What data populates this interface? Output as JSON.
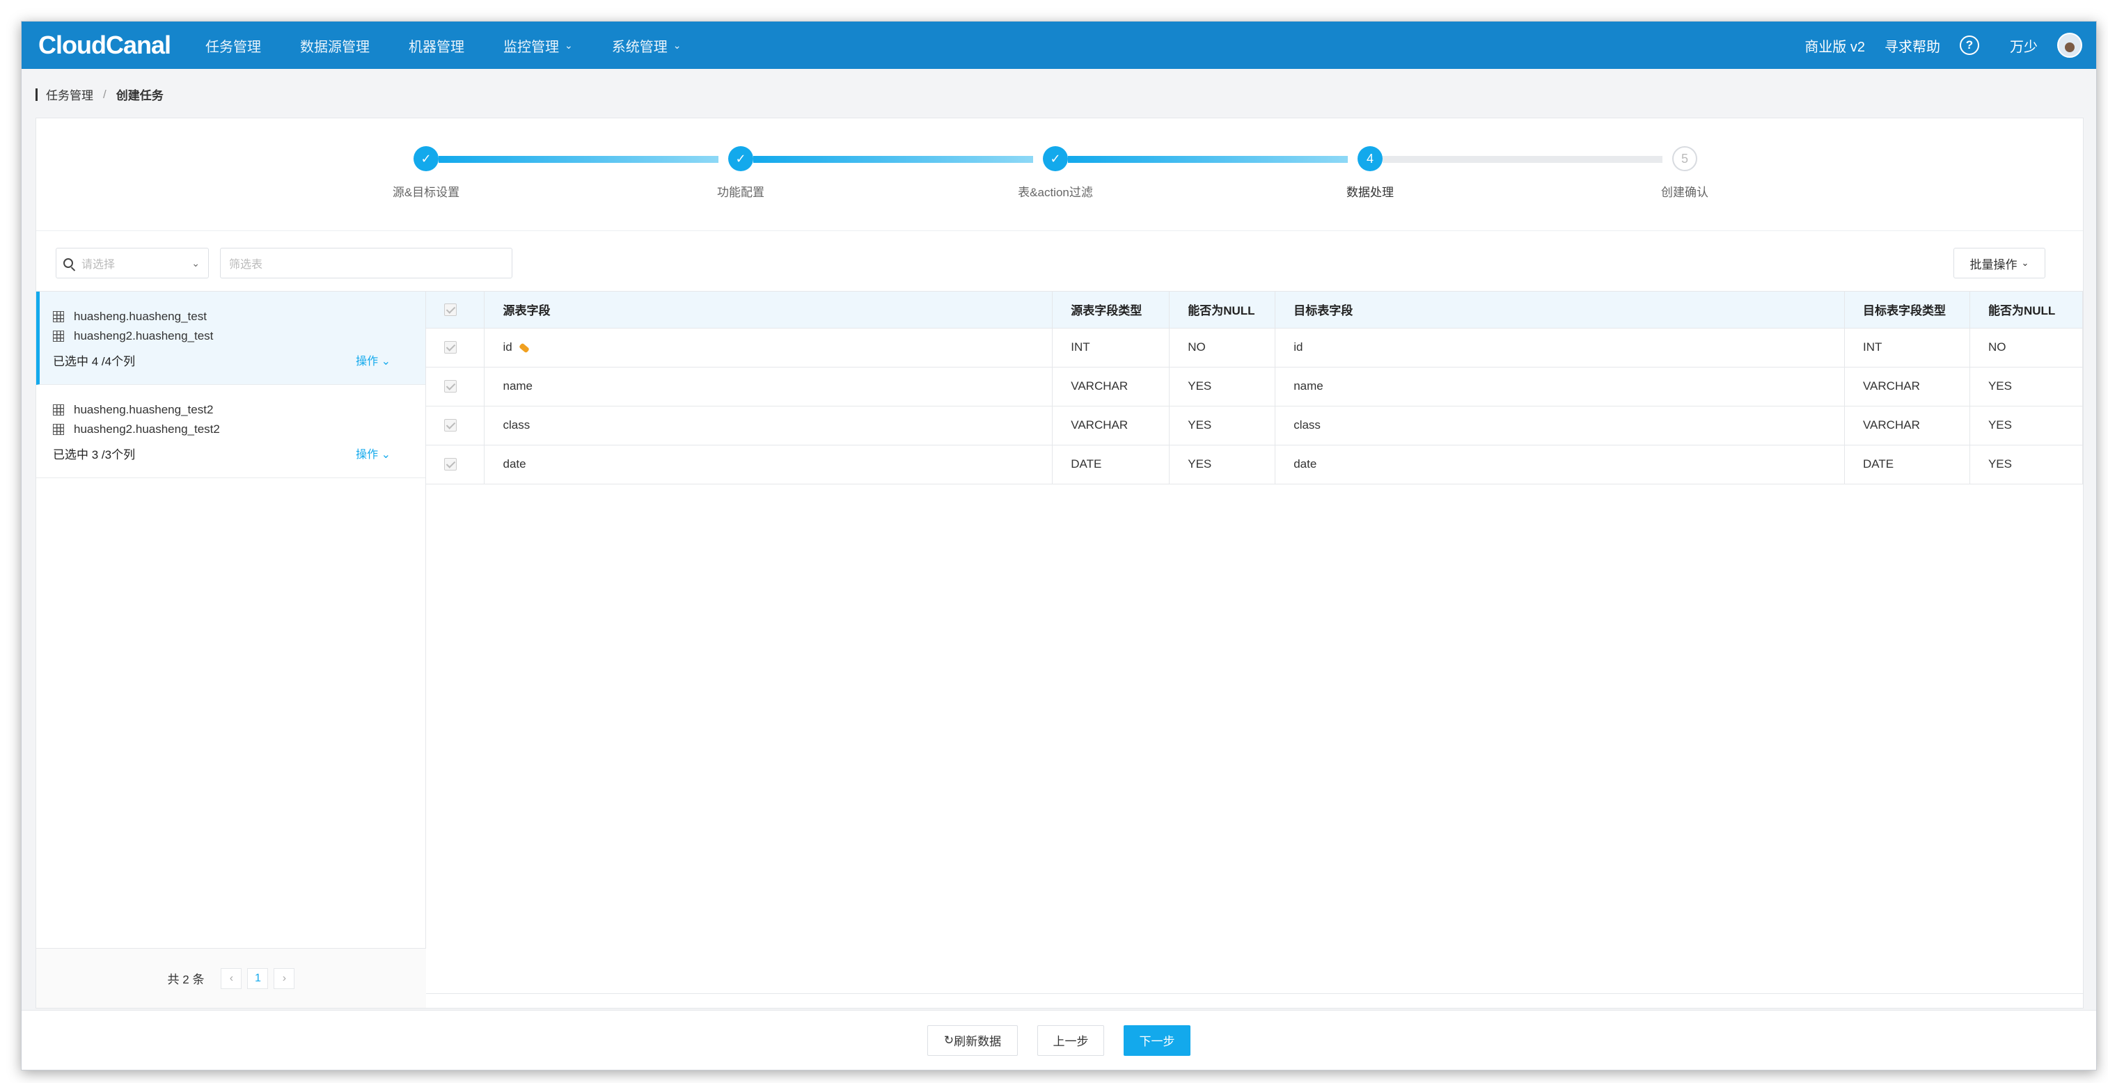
{
  "nav": {
    "logo": "CloudCanal",
    "items": [
      {
        "label": "任务管理",
        "dropdown": false
      },
      {
        "label": "数据源管理",
        "dropdown": false
      },
      {
        "label": "机器管理",
        "dropdown": false
      },
      {
        "label": "监控管理",
        "dropdown": true
      },
      {
        "label": "系统管理",
        "dropdown": true
      }
    ],
    "edition": "商业版 v2",
    "help": "寻求帮助",
    "help_icon": "?",
    "user": "万少"
  },
  "breadcrumb": {
    "parent": "任务管理",
    "separator": "/",
    "current": "创建任务"
  },
  "steps": [
    {
      "label": "源&目标设置",
      "status": "done",
      "number": "1"
    },
    {
      "label": "功能配置",
      "status": "done",
      "number": "2"
    },
    {
      "label": "表&action过滤",
      "status": "done",
      "number": "3"
    },
    {
      "label": "数据处理",
      "status": "active",
      "number": "4"
    },
    {
      "label": "创建确认",
      "status": "todo",
      "number": "5"
    }
  ],
  "filters": {
    "select_placeholder": "请选择",
    "input_placeholder": "筛选表",
    "batch_label": "批量操作"
  },
  "table_groups": [
    {
      "tables": [
        "huasheng.huasheng_test",
        "huasheng2.huasheng_test"
      ],
      "selected": "已选中 4 /4个列",
      "op": "操作",
      "active": true
    },
    {
      "tables": [
        "huasheng.huasheng_test2",
        "huasheng2.huasheng_test2"
      ],
      "selected": "已选中 3 /3个列",
      "op": "操作",
      "active": false
    }
  ],
  "pager": {
    "total": "共 2 条",
    "prev": "‹",
    "current": "1",
    "next": "›"
  },
  "columns": {
    "headers": [
      "源表字段",
      "源表字段类型",
      "能否为NULL",
      "目标表字段",
      "目标表字段类型",
      "能否为NULL"
    ],
    "rows": [
      {
        "src": "id",
        "src_type": "INT",
        "src_null": "NO",
        "dst": "id",
        "dst_type": "INT",
        "dst_null": "NO",
        "key": true
      },
      {
        "src": "name",
        "src_type": "VARCHAR",
        "src_null": "YES",
        "dst": "name",
        "dst_type": "VARCHAR",
        "dst_null": "YES",
        "key": false
      },
      {
        "src": "class",
        "src_type": "VARCHAR",
        "src_null": "YES",
        "dst": "class",
        "dst_type": "VARCHAR",
        "dst_null": "YES",
        "key": false
      },
      {
        "src": "date",
        "src_type": "DATE",
        "src_null": "YES",
        "dst": "date",
        "dst_type": "DATE",
        "dst_null": "YES",
        "key": false
      }
    ]
  },
  "footer": {
    "refresh": "刷新数据",
    "prev": "上一步",
    "next": "下一步"
  },
  "colors": {
    "nav_bg": "#1585cc",
    "accent": "#13a9ec"
  }
}
